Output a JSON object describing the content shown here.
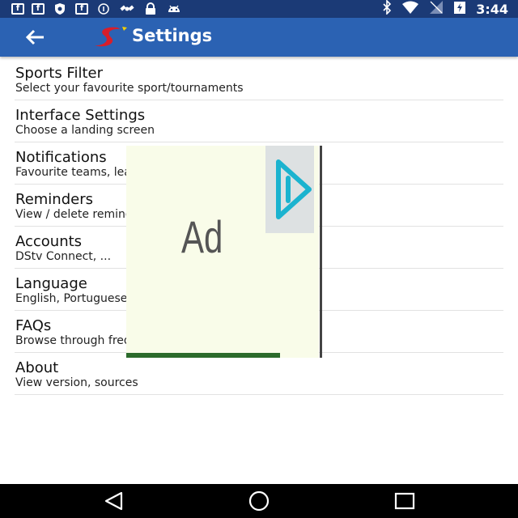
{
  "status_bar": {
    "left_icons": [
      "facebook-icon",
      "facebook-icon",
      "shield-icon",
      "facebook-icon",
      "data-saver-icon",
      "satellite-icon",
      "lock-icon",
      "android-icon"
    ],
    "right_icons": [
      "bluetooth-icon",
      "wifi-icon",
      "signal-icon",
      "battery-icon"
    ],
    "time": "3:44"
  },
  "app_bar": {
    "title": "Settings",
    "back_icon": "arrow-back-icon",
    "logo": "supersport-logo"
  },
  "settings": [
    {
      "title": "Sports Filter",
      "subtitle": "Select your favourite sport/tournaments"
    },
    {
      "title": "Interface Settings",
      "subtitle": "Choose a landing screen"
    },
    {
      "title": "Notifications",
      "subtitle": "Favourite teams, leagues and notifications"
    },
    {
      "title": "Reminders",
      "subtitle": "View / delete reminders"
    },
    {
      "title": "Accounts",
      "subtitle": "DStv Connect, ..."
    },
    {
      "title": "Language",
      "subtitle": "English, Portuguese"
    },
    {
      "title": "FAQs",
      "subtitle": "Browse through frequently asked questions"
    },
    {
      "title": "About",
      "subtitle": "View version, sources"
    }
  ],
  "ad": {
    "label": "Ad",
    "play_icon": "play-icon"
  },
  "nav_bar": {
    "icons": [
      "back-triangle-icon",
      "home-circle-icon",
      "recents-square-icon"
    ]
  },
  "colors": {
    "status_bar": "#1b3a76",
    "app_bar": "#2b62b3",
    "ad_background": "#f9fce9"
  }
}
